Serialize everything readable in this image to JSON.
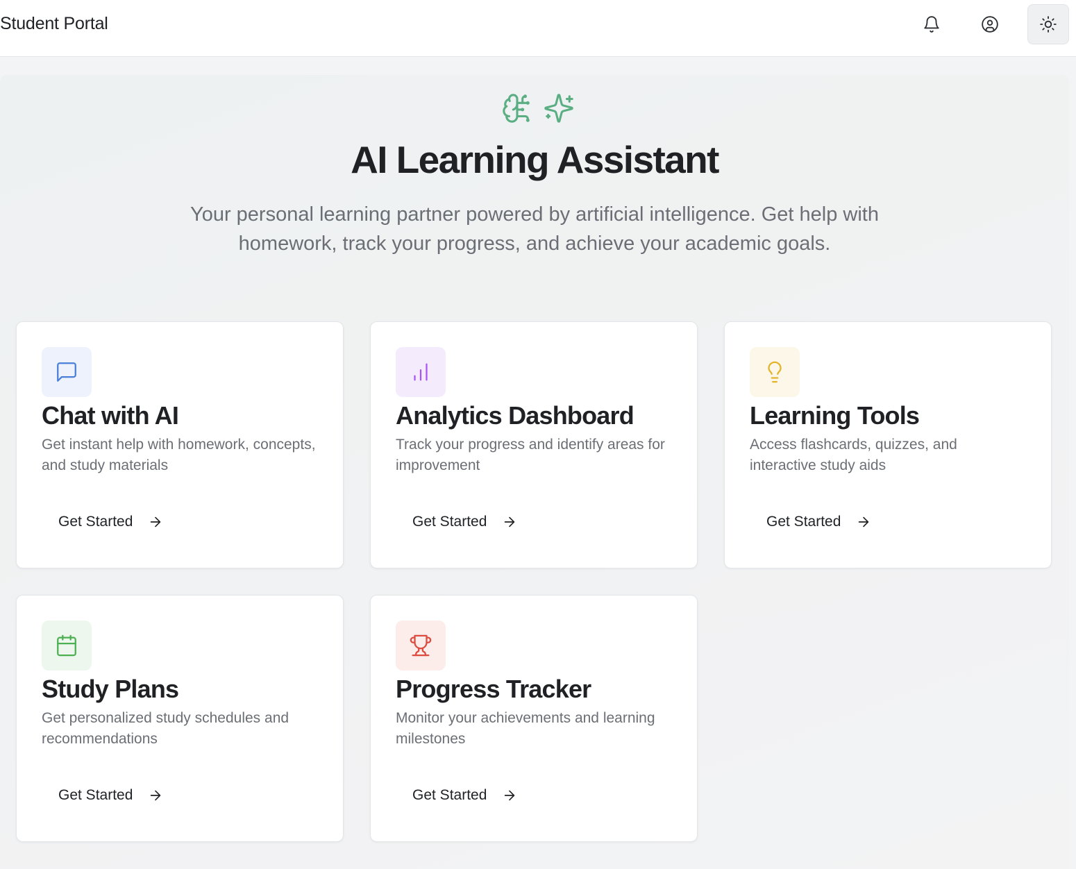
{
  "header": {
    "title": "Student Portal",
    "icons": [
      "bell-icon",
      "user-circle-icon",
      "sun-icon"
    ]
  },
  "hero": {
    "icons": [
      "brain-icon",
      "sparkles-icon"
    ],
    "title": "AI Learning Assistant",
    "subtitle": "Your personal learning partner powered by artificial intelligence. Get help with homework, track your progress, and achieve your academic goals."
  },
  "cards": [
    {
      "title": "Chat with AI",
      "description": "Get instant help with homework, concepts, and study materials",
      "cta": "Get Started",
      "icon": "message-square-icon",
      "accent": "#4a7fd8",
      "tint": "#edf2fd"
    },
    {
      "title": "Analytics Dashboard",
      "description": "Track your progress and identify areas for improvement",
      "cta": "Get Started",
      "icon": "bar-chart-icon",
      "accent": "#a855f7",
      "tint": "#f4ecfd"
    },
    {
      "title": "Learning Tools",
      "description": "Access flashcards, quizzes, and interactive study aids",
      "cta": "Get Started",
      "icon": "lightbulb-icon",
      "accent": "#e3b42a",
      "tint": "#fcf7e8"
    },
    {
      "title": "Study Plans",
      "description": "Get personalized study schedules and recommendations",
      "cta": "Get Started",
      "icon": "calendar-icon",
      "accent": "#4caf50",
      "tint": "#edf7ee"
    },
    {
      "title": "Progress Tracker",
      "description": "Monitor your achievements and learning milestones",
      "cta": "Get Started",
      "icon": "trophy-icon",
      "accent": "#dc4b3e",
      "tint": "#fcecea"
    }
  ],
  "colors": {
    "brand_green": "#5aae82",
    "text": "#1f2124",
    "muted": "#6b6f75"
  }
}
